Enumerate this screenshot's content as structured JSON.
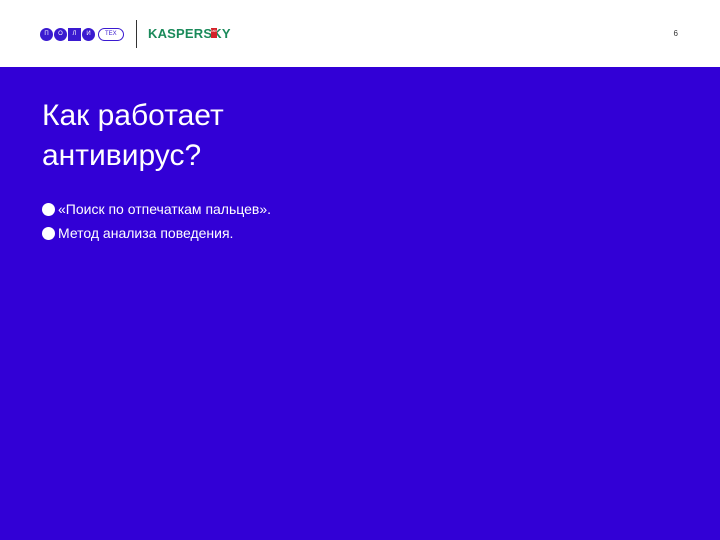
{
  "header": {
    "polytech_logo": {
      "letters": [
        "П",
        "О",
        "Л",
        "И"
      ],
      "suffix": "ТЕХ"
    },
    "kaspersky_logo": {
      "text": "KASPERSKY",
      "lab_badge": "lab",
      "color": "#1a8a5a",
      "badge_color": "#d4232a"
    },
    "page_number": "6"
  },
  "slide": {
    "title_line1": "Как работает",
    "title_line2": "антивирус?",
    "bullets": [
      {
        "text": "«Поиск по отпечаткам пальцев»."
      },
      {
        "text": "Метод анализа поведения."
      }
    ]
  },
  "colors": {
    "background": "#3200d6",
    "header_background": "#ffffff",
    "brand_purple": "#3a1ad0",
    "text": "#ffffff"
  }
}
